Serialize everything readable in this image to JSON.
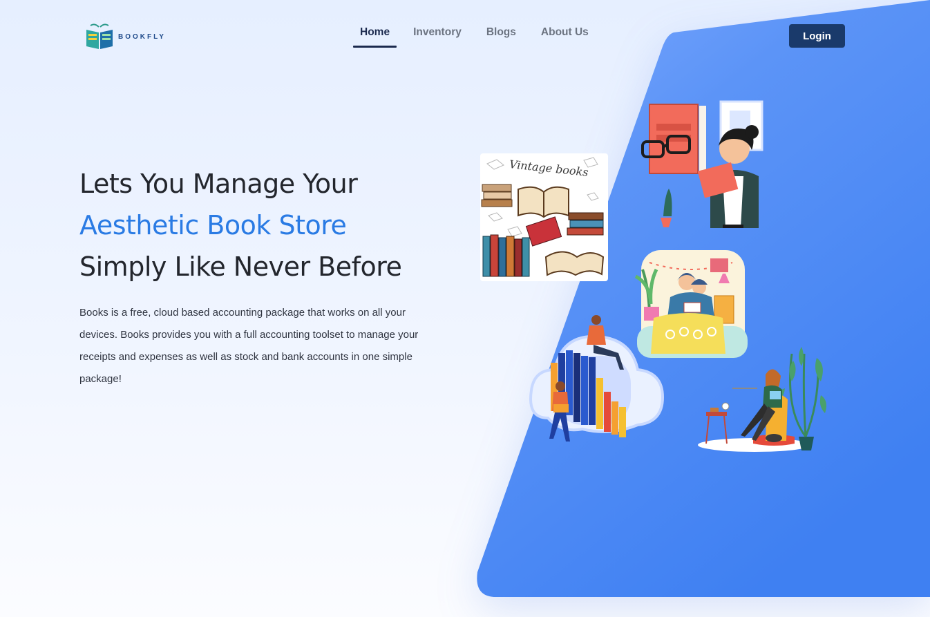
{
  "brand": {
    "name": "BOOKFLY"
  },
  "nav": {
    "items": [
      {
        "label": "Home",
        "active": true
      },
      {
        "label": "Inventory",
        "active": false
      },
      {
        "label": "Blogs",
        "active": false
      },
      {
        "label": "About Us",
        "active": false
      }
    ],
    "login_label": "Login"
  },
  "hero": {
    "line1": "Lets You Manage Your",
    "line2": "Aesthetic Book Store",
    "line3": "Simply Like Never Before",
    "description": "Books is a free, cloud based accounting package that works on all your devices. Books provides you with a full accounting toolset to manage your receipts and expenses as well as stock and bank accounts in one simple package!"
  },
  "illustrations": {
    "vintage_caption": "Vintage books"
  },
  "colors": {
    "accent": "#2a7be4",
    "primary_dark": "#1a3a6b",
    "panel_blue": "#4a8af5"
  }
}
